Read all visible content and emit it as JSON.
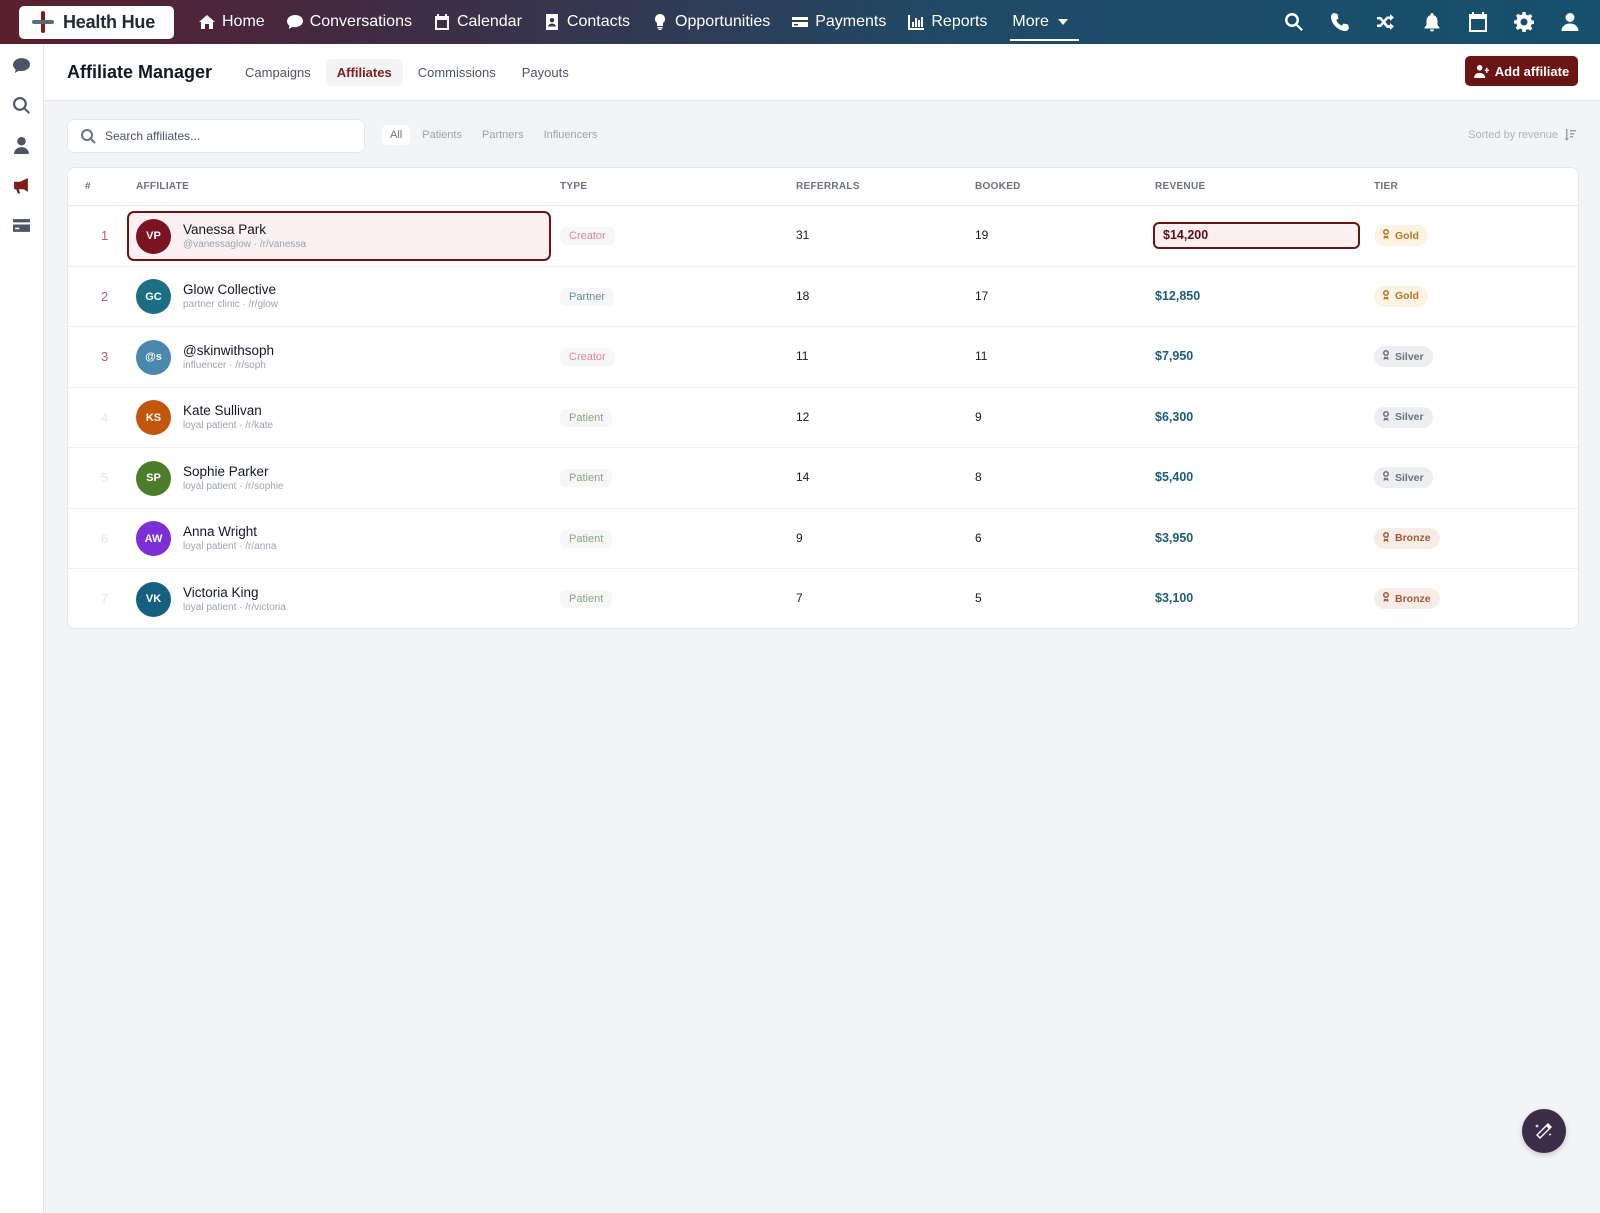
{
  "app": {
    "logo_text": "Health Hue"
  },
  "nav": {
    "items": [
      {
        "label": "Home",
        "icon": "home-icon"
      },
      {
        "label": "Conversations",
        "icon": "chat-icon"
      },
      {
        "label": "Calendar",
        "icon": "calendar-icon"
      },
      {
        "label": "Contacts",
        "icon": "contact-card-icon"
      },
      {
        "label": "Opportunities",
        "icon": "lightbulb-icon"
      },
      {
        "label": "Payments",
        "icon": "credit-card-icon"
      },
      {
        "label": "Reports",
        "icon": "bar-chart-icon"
      }
    ],
    "more_label": "More",
    "right_icons": [
      "search-icon",
      "phone-icon",
      "shuffle-icon",
      "bell-icon",
      "calendar-icon",
      "gear-icon",
      "user-icon"
    ]
  },
  "rail": {
    "icons": [
      "chat-icon",
      "search-icon",
      "user-icon",
      "megaphone-icon",
      "credit-card-icon"
    ],
    "active": "megaphone-icon"
  },
  "header": {
    "title": "Affiliate Manager",
    "tabs": [
      "Campaigns",
      "Affiliates",
      "Commissions",
      "Payouts"
    ],
    "active_tab": "Affiliates",
    "add_button": "Add affiliate"
  },
  "filters": {
    "search_placeholder": "Search affiliates...",
    "options": [
      "All",
      "Patients",
      "Partners",
      "Influencers"
    ],
    "active": "All",
    "sort_label": "Sorted by revenue"
  },
  "table": {
    "columns": {
      "rank": "#",
      "affiliate": "AFFILIATE",
      "type": "TYPE",
      "referrals": "REFERRALS",
      "booked": "BOOKED",
      "revenue": "REVENUE",
      "tier": "TIER"
    },
    "rows": [
      {
        "rank": "1",
        "initials": "VP",
        "name": "Vanessa Park",
        "sub": "@vanessaglow · /r/vanessa",
        "type": "Creator",
        "referrals": "31",
        "booked": "19",
        "revenue": "$14,200",
        "tier": "Gold",
        "avatar_color": "#7a1420",
        "selected": true
      },
      {
        "rank": "2",
        "initials": "GC",
        "name": "Glow Collective",
        "sub": "partner clinic · /r/glow",
        "type": "Partner",
        "referrals": "18",
        "booked": "17",
        "revenue": "$12,850",
        "tier": "Gold",
        "avatar_color": "#1b6e84"
      },
      {
        "rank": "3",
        "initials": "@s",
        "name": "@skinwithsoph",
        "sub": "influencer · /r/soph",
        "type": "Creator",
        "referrals": "11",
        "booked": "11",
        "revenue": "$7,950",
        "tier": "Silver",
        "avatar_color": "#4a88ae"
      },
      {
        "rank": "4",
        "initials": "KS",
        "name": "Kate Sullivan",
        "sub": "loyal patient · /r/kate",
        "type": "Patient",
        "referrals": "12",
        "booked": "9",
        "revenue": "$6,300",
        "tier": "Silver",
        "avatar_color": "#c2570c"
      },
      {
        "rank": "5",
        "initials": "SP",
        "name": "Sophie Parker",
        "sub": "loyal patient · /r/sophie",
        "type": "Patient",
        "referrals": "14",
        "booked": "8",
        "revenue": "$5,400",
        "tier": "Silver",
        "avatar_color": "#4d7c2a"
      },
      {
        "rank": "6",
        "initials": "AW",
        "name": "Anna Wright",
        "sub": "loyal patient · /r/anna",
        "type": "Patient",
        "referrals": "9",
        "booked": "6",
        "revenue": "$3,950",
        "tier": "Bronze",
        "avatar_color": "#7c2fd6"
      },
      {
        "rank": "7",
        "initials": "VK",
        "name": "Victoria King",
        "sub": "loyal patient · /r/victoria",
        "type": "Patient",
        "referrals": "7",
        "booked": "5",
        "revenue": "$3,100",
        "tier": "Bronze",
        "avatar_color": "#15607f"
      }
    ]
  },
  "colors": {
    "accent": "#6b1414",
    "revenue": "#1e5d7a",
    "creator": "#e0869a",
    "partner": "#6b8e9e",
    "patient": "#8aa57f"
  }
}
